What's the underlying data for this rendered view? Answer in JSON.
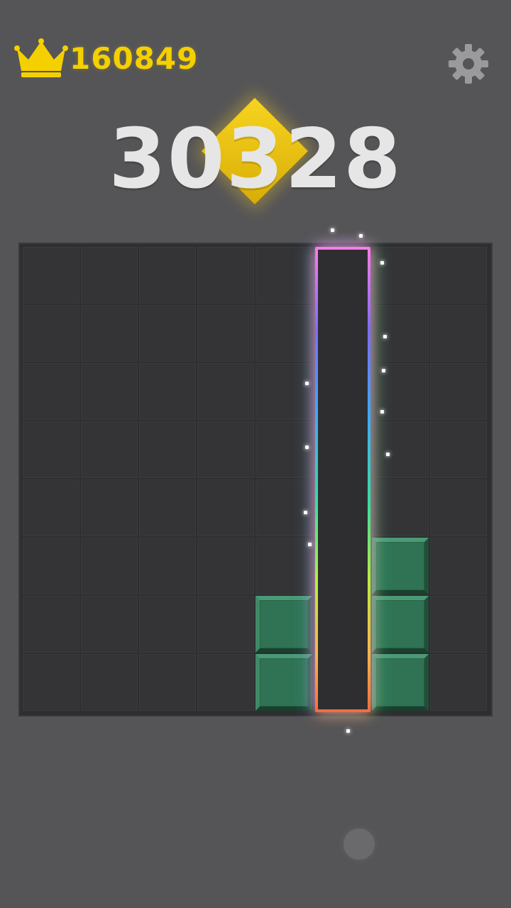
{
  "header": {
    "best_score": "160849",
    "best_icon": "crown-icon",
    "settings_icon": "gear-icon",
    "best_color": "#f5d000"
  },
  "score": {
    "current": "30328",
    "badge_icon": "diamond-icon",
    "badge_color": "#f2c811"
  },
  "board": {
    "rows": 8,
    "cols": 8,
    "block_color": "#2f7354",
    "filled_cells": [
      {
        "row": 5,
        "col": 6
      },
      {
        "row": 6,
        "col": 4
      },
      {
        "row": 6,
        "col": 6
      },
      {
        "row": 7,
        "col": 4
      },
      {
        "row": 7,
        "col": 6
      }
    ],
    "highlighted_column": 5
  }
}
